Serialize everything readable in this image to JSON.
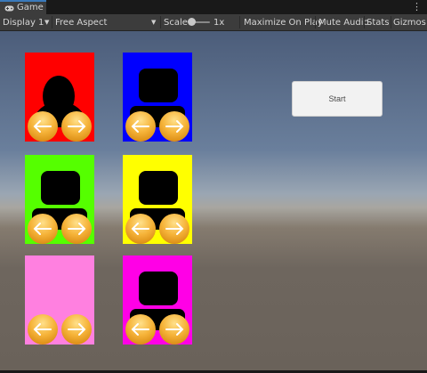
{
  "window": {
    "tab_title": "Game"
  },
  "toolbar": {
    "display": "Display 1",
    "aspect": "Free Aspect",
    "scale_label": "Scale",
    "scale_value": "1x",
    "maximize": "Maximize On Play",
    "mute": "Mute Audio",
    "stats": "Stats",
    "gizmos": "Gizmos"
  },
  "scene": {
    "start_label": "Start",
    "cards": [
      {
        "color": "#ff0000",
        "head": "circle"
      },
      {
        "color": "#0000ff",
        "head": "box"
      },
      {
        "color": "#55ff00",
        "head": "box"
      },
      {
        "color": "#ffff00",
        "head": "box"
      },
      {
        "color": "#ff80e0",
        "head": "none"
      },
      {
        "color": "#ff00e6",
        "head": "box"
      }
    ]
  }
}
